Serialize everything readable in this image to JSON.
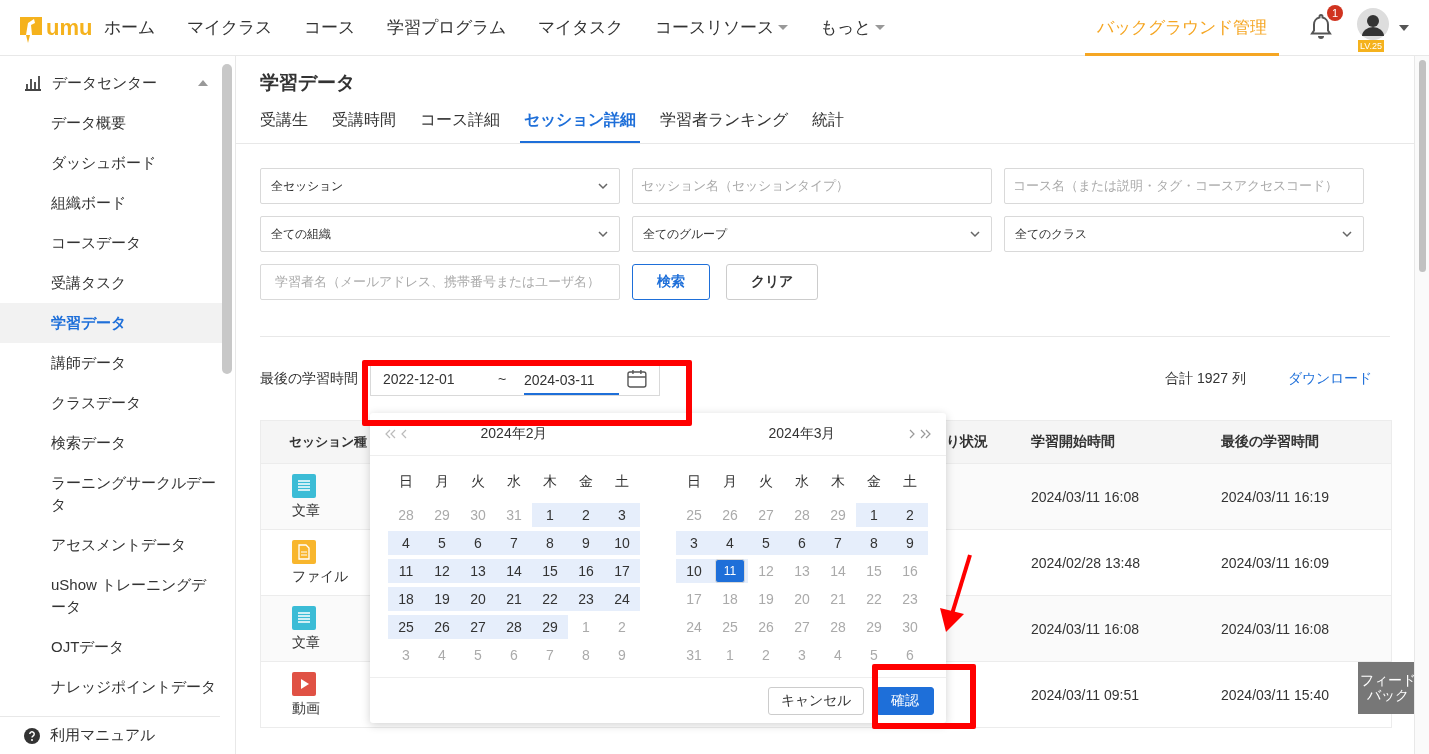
{
  "logo": {
    "text": "umu"
  },
  "nav": {
    "items": [
      {
        "label": "ホーム",
        "dropdown": false
      },
      {
        "label": "マイクラス",
        "dropdown": false
      },
      {
        "label": "コース",
        "dropdown": false
      },
      {
        "label": "学習プログラム",
        "dropdown": false
      },
      {
        "label": "マイタスク",
        "dropdown": false
      },
      {
        "label": "コースリソース",
        "dropdown": true
      },
      {
        "label": "もっと",
        "dropdown": true
      }
    ],
    "admin": {
      "label": "バックグラウンド管理",
      "selected": true
    },
    "notifications": {
      "count": "1"
    },
    "user": {
      "level": "LV.25"
    }
  },
  "sidebar": {
    "group": {
      "label": "データセンター",
      "expanded": true,
      "children": [
        {
          "label": "データ概要",
          "selected": false
        },
        {
          "label": "ダッシュボード",
          "selected": false
        },
        {
          "label": "組織ボード",
          "selected": false
        },
        {
          "label": "コースデータ",
          "selected": false
        },
        {
          "label": "受講タスク",
          "selected": false
        },
        {
          "label": "学習データ",
          "selected": true
        },
        {
          "label": "講師データ",
          "selected": false
        },
        {
          "label": "クラスデータ",
          "selected": false
        },
        {
          "label": "検索データ",
          "selected": false
        },
        {
          "label": "ラーニングサークルデータ",
          "selected": false
        },
        {
          "label": "アセスメントデータ",
          "selected": false
        },
        {
          "label": "uShow トレーニングデータ",
          "selected": false
        },
        {
          "label": "OJTデータ",
          "selected": false
        },
        {
          "label": "ナレッジポイントデータ",
          "selected": false
        }
      ]
    },
    "footer": {
      "label": "利用マニュアル"
    }
  },
  "page": {
    "title": "学習データ",
    "tabs": [
      {
        "label": "受講生",
        "selected": false
      },
      {
        "label": "受講時間",
        "selected": false
      },
      {
        "label": "コース詳細",
        "selected": false
      },
      {
        "label": "セッション詳細",
        "selected": true
      },
      {
        "label": "学習者ランキング",
        "selected": false
      },
      {
        "label": "統計",
        "selected": false
      }
    ],
    "filters": [
      {
        "kind": "select",
        "value": "全セッション"
      },
      {
        "kind": "input",
        "placeholder": "セッション名（セッションタイプ）"
      },
      {
        "kind": "input",
        "placeholder": "コース名（または説明・タグ・コースアクセスコード）"
      },
      {
        "kind": "select",
        "value": "全ての組織"
      },
      {
        "kind": "select",
        "value": "全てのグループ"
      },
      {
        "kind": "select",
        "value": "全てのクラス"
      },
      {
        "kind": "input",
        "placeholder": "学習者名（メールアドレス、携帯番号またはユーザ名）"
      },
      {
        "kind": "primary",
        "label": "検索"
      },
      {
        "kind": "button",
        "label": "クリア"
      }
    ],
    "date_filter": {
      "label": "最後の学習時間",
      "start": "2022-12-01",
      "separator": "~",
      "end": "2024-03-11"
    },
    "total": "合計 1927 列",
    "download": "ダウンロード",
    "table": {
      "columns": [
        "セッション種",
        "り状況",
        "学習開始時間",
        "最後の学習時間"
      ],
      "rows": [
        {
          "kind": "article",
          "type": "文章",
          "start": "2024/03/11 16:08",
          "last": "2024/03/11 16:19"
        },
        {
          "kind": "file",
          "type": "ファイル",
          "start": "2024/02/28 13:48",
          "last": "2024/03/11 16:09"
        },
        {
          "kind": "article",
          "type": "文章",
          "start": "2024/03/11 16:08",
          "last": "2024/03/11 16:08"
        },
        {
          "kind": "video",
          "type": "動画",
          "start": "2024/03/11 09:51",
          "last": "2024/03/11 15:40"
        }
      ]
    }
  },
  "date_picker": {
    "panels": [
      {
        "title": "2024年2月",
        "weekdays": [
          "日",
          "月",
          "火",
          "水",
          "木",
          "金",
          "土"
        ],
        "weeks": [
          [
            {
              "day": "28",
              "muted": true,
              "in_range": false,
              "selected": false
            },
            {
              "day": "29",
              "muted": true,
              "in_range": false,
              "selected": false
            },
            {
              "day": "30",
              "muted": true,
              "in_range": false,
              "selected": false
            },
            {
              "day": "31",
              "muted": true,
              "in_range": false,
              "selected": false
            },
            {
              "day": "1",
              "muted": false,
              "in_range": true,
              "selected": false
            },
            {
              "day": "2",
              "muted": false,
              "in_range": true,
              "selected": false
            },
            {
              "day": "3",
              "muted": false,
              "in_range": true,
              "selected": false
            }
          ],
          [
            {
              "day": "4",
              "muted": false,
              "in_range": true,
              "selected": false
            },
            {
              "day": "5",
              "muted": false,
              "in_range": true,
              "selected": false
            },
            {
              "day": "6",
              "muted": false,
              "in_range": true,
              "selected": false
            },
            {
              "day": "7",
              "muted": false,
              "in_range": true,
              "selected": false
            },
            {
              "day": "8",
              "muted": false,
              "in_range": true,
              "selected": false
            },
            {
              "day": "9",
              "muted": false,
              "in_range": true,
              "selected": false
            },
            {
              "day": "10",
              "muted": false,
              "in_range": true,
              "selected": false
            }
          ],
          [
            {
              "day": "11",
              "muted": false,
              "in_range": true,
              "selected": false
            },
            {
              "day": "12",
              "muted": false,
              "in_range": true,
              "selected": false
            },
            {
              "day": "13",
              "muted": false,
              "in_range": true,
              "selected": false
            },
            {
              "day": "14",
              "muted": false,
              "in_range": true,
              "selected": false
            },
            {
              "day": "15",
              "muted": false,
              "in_range": true,
              "selected": false
            },
            {
              "day": "16",
              "muted": false,
              "in_range": true,
              "selected": false
            },
            {
              "day": "17",
              "muted": false,
              "in_range": true,
              "selected": false
            }
          ],
          [
            {
              "day": "18",
              "muted": false,
              "in_range": true,
              "selected": false
            },
            {
              "day": "19",
              "muted": false,
              "in_range": true,
              "selected": false
            },
            {
              "day": "20",
              "muted": false,
              "in_range": true,
              "selected": false
            },
            {
              "day": "21",
              "muted": false,
              "in_range": true,
              "selected": false
            },
            {
              "day": "22",
              "muted": false,
              "in_range": true,
              "selected": false
            },
            {
              "day": "23",
              "muted": false,
              "in_range": true,
              "selected": false
            },
            {
              "day": "24",
              "muted": false,
              "in_range": true,
              "selected": false
            }
          ],
          [
            {
              "day": "25",
              "muted": false,
              "in_range": true,
              "selected": false
            },
            {
              "day": "26",
              "muted": false,
              "in_range": true,
              "selected": false
            },
            {
              "day": "27",
              "muted": false,
              "in_range": true,
              "selected": false
            },
            {
              "day": "28",
              "muted": false,
              "in_range": true,
              "selected": false
            },
            {
              "day": "29",
              "muted": false,
              "in_range": true,
              "selected": false
            },
            {
              "day": "1",
              "muted": true,
              "in_range": false,
              "selected": false
            },
            {
              "day": "2",
              "muted": true,
              "in_range": false,
              "selected": false
            }
          ],
          [
            {
              "day": "3",
              "muted": true,
              "in_range": false,
              "selected": false
            },
            {
              "day": "4",
              "muted": true,
              "in_range": false,
              "selected": false
            },
            {
              "day": "5",
              "muted": true,
              "in_range": false,
              "selected": false
            },
            {
              "day": "6",
              "muted": true,
              "in_range": false,
              "selected": false
            },
            {
              "day": "7",
              "muted": true,
              "in_range": false,
              "selected": false
            },
            {
              "day": "8",
              "muted": true,
              "in_range": false,
              "selected": false
            },
            {
              "day": "9",
              "muted": true,
              "in_range": false,
              "selected": false
            }
          ]
        ]
      },
      {
        "title": "2024年3月",
        "weekdays": [
          "日",
          "月",
          "火",
          "水",
          "木",
          "金",
          "土"
        ],
        "weeks": [
          [
            {
              "day": "25",
              "muted": true,
              "in_range": false,
              "selected": false
            },
            {
              "day": "26",
              "muted": true,
              "in_range": false,
              "selected": false
            },
            {
              "day": "27",
              "muted": true,
              "in_range": false,
              "selected": false
            },
            {
              "day": "28",
              "muted": true,
              "in_range": false,
              "selected": false
            },
            {
              "day": "29",
              "muted": true,
              "in_range": false,
              "selected": false
            },
            {
              "day": "1",
              "muted": false,
              "in_range": true,
              "selected": false
            },
            {
              "day": "2",
              "muted": false,
              "in_range": true,
              "selected": false
            }
          ],
          [
            {
              "day": "3",
              "muted": false,
              "in_range": true,
              "selected": false
            },
            {
              "day": "4",
              "muted": false,
              "in_range": true,
              "selected": false
            },
            {
              "day": "5",
              "muted": false,
              "in_range": true,
              "selected": false
            },
            {
              "day": "6",
              "muted": false,
              "in_range": true,
              "selected": false
            },
            {
              "day": "7",
              "muted": false,
              "in_range": true,
              "selected": false
            },
            {
              "day": "8",
              "muted": false,
              "in_range": true,
              "selected": false
            },
            {
              "day": "9",
              "muted": false,
              "in_range": true,
              "selected": false
            }
          ],
          [
            {
              "day": "10",
              "muted": false,
              "in_range": true,
              "selected": false
            },
            {
              "day": "11",
              "muted": false,
              "in_range": true,
              "selected": true
            },
            {
              "day": "12",
              "muted": true,
              "in_range": false,
              "selected": false
            },
            {
              "day": "13",
              "muted": true,
              "in_range": false,
              "selected": false
            },
            {
              "day": "14",
              "muted": true,
              "in_range": false,
              "selected": false
            },
            {
              "day": "15",
              "muted": true,
              "in_range": false,
              "selected": false
            },
            {
              "day": "16",
              "muted": true,
              "in_range": false,
              "selected": false
            }
          ],
          [
            {
              "day": "17",
              "muted": true,
              "in_range": false,
              "selected": false
            },
            {
              "day": "18",
              "muted": true,
              "in_range": false,
              "selected": false
            },
            {
              "day": "19",
              "muted": true,
              "in_range": false,
              "selected": false
            },
            {
              "day": "20",
              "muted": true,
              "in_range": false,
              "selected": false
            },
            {
              "day": "21",
              "muted": true,
              "in_range": false,
              "selected": false
            },
            {
              "day": "22",
              "muted": true,
              "in_range": false,
              "selected": false
            },
            {
              "day": "23",
              "muted": true,
              "in_range": false,
              "selected": false
            }
          ],
          [
            {
              "day": "24",
              "muted": true,
              "in_range": false,
              "selected": false
            },
            {
              "day": "25",
              "muted": true,
              "in_range": false,
              "selected": false
            },
            {
              "day": "26",
              "muted": true,
              "in_range": false,
              "selected": false
            },
            {
              "day": "27",
              "muted": true,
              "in_range": false,
              "selected": false
            },
            {
              "day": "28",
              "muted": true,
              "in_range": false,
              "selected": false
            },
            {
              "day": "29",
              "muted": true,
              "in_range": false,
              "selected": false
            },
            {
              "day": "30",
              "muted": true,
              "in_range": false,
              "selected": false
            }
          ],
          [
            {
              "day": "31",
              "muted": true,
              "in_range": false,
              "selected": false
            },
            {
              "day": "1",
              "muted": true,
              "in_range": false,
              "selected": false
            },
            {
              "day": "2",
              "muted": true,
              "in_range": false,
              "selected": false
            },
            {
              "day": "3",
              "muted": true,
              "in_range": false,
              "selected": false
            },
            {
              "day": "4",
              "muted": true,
              "in_range": false,
              "selected": false
            },
            {
              "day": "5",
              "muted": true,
              "in_range": false,
              "selected": false
            },
            {
              "day": "6",
              "muted": true,
              "in_range": false,
              "selected": false
            }
          ]
        ]
      }
    ],
    "cancel": "キャンセル",
    "confirm": "確認"
  },
  "feedback": "フィードバック"
}
